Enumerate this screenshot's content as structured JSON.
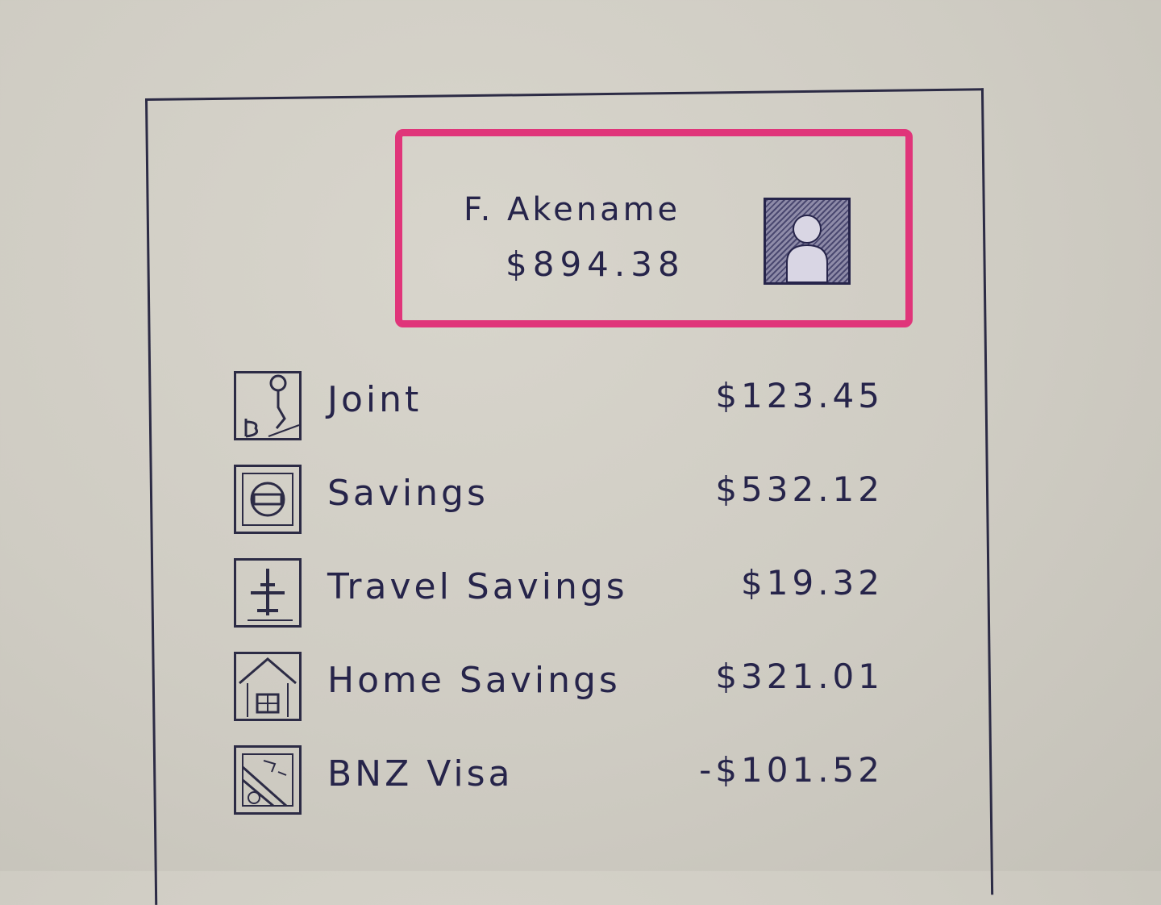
{
  "profile": {
    "name": "F. Akename",
    "balance": "$894.38",
    "avatar_icon": "user-avatar-icon",
    "highlight_color": "#e0357a"
  },
  "accounts": [
    {
      "label": "Joint",
      "amount": "$123.45",
      "icon": "couple-icon"
    },
    {
      "label": "Savings",
      "amount": "$532.12",
      "icon": "cash-icon"
    },
    {
      "label": "Travel Savings",
      "amount": "$19.32",
      "icon": "airplane-icon"
    },
    {
      "label": "Home Savings",
      "amount": "$321.01",
      "icon": "house-icon"
    },
    {
      "label": "BNZ Visa",
      "amount": "-$101.52",
      "icon": "card-icon"
    }
  ]
}
